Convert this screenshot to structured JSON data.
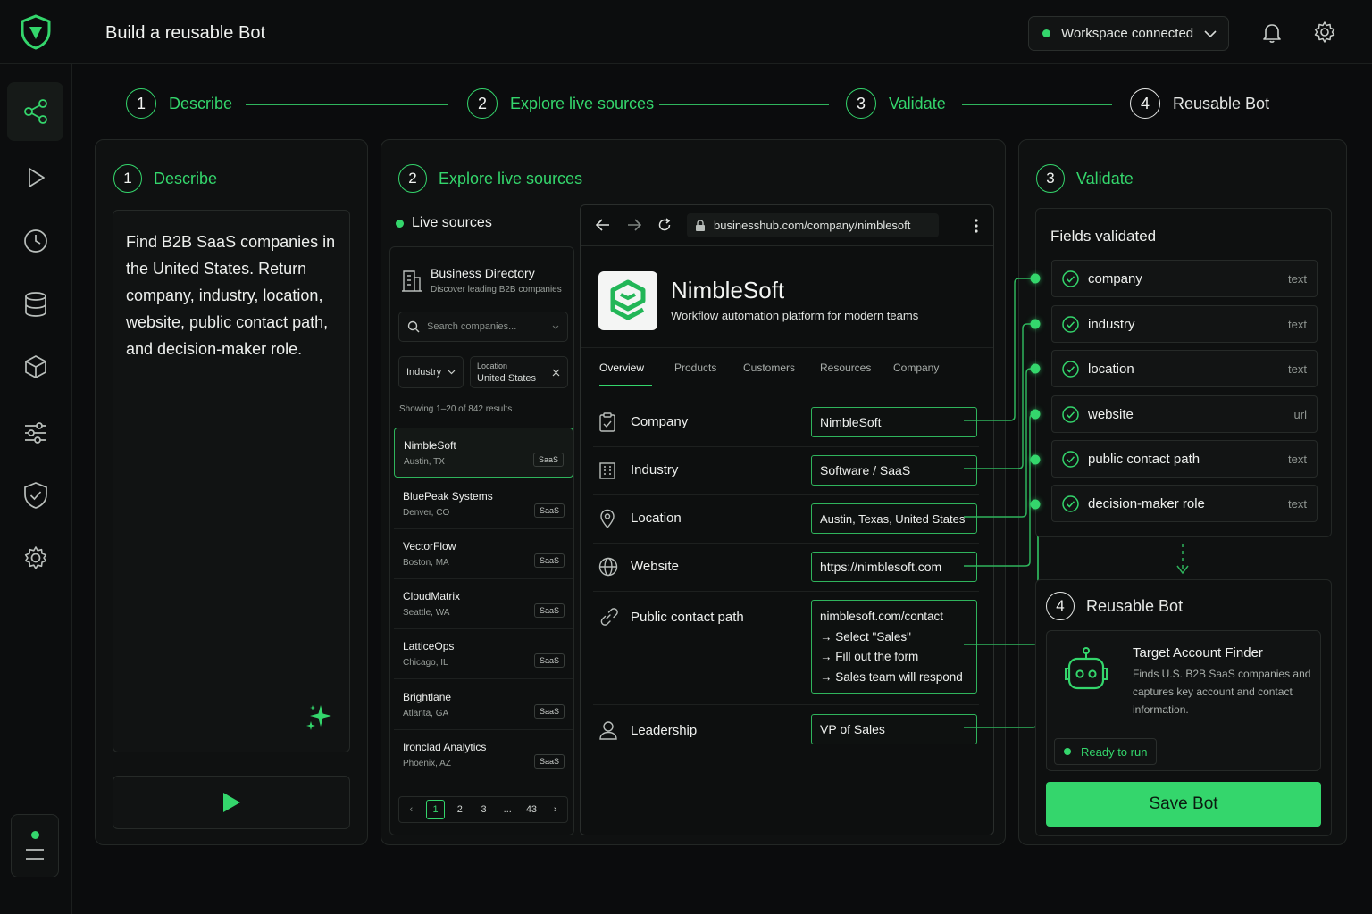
{
  "app": {
    "title": "Build a reusable Bot",
    "workspace_status": "Workspace connected"
  },
  "colors": {
    "accent": "#34d66c",
    "background": "#0b0c0d",
    "panel": "#0f1111"
  },
  "icons": {
    "logo": "shield-logo-icon",
    "topbar": [
      "bell-icon",
      "gear-icon"
    ],
    "sidebar": [
      "share-nodes-icon",
      "play-icon",
      "clock-icon",
      "database-icon",
      "cube-icon",
      "sliders-icon",
      "shield-check-icon",
      "settings-icon"
    ]
  },
  "stepper": [
    {
      "num": "1",
      "label": "Describe"
    },
    {
      "num": "2",
      "label": "Explore live sources"
    },
    {
      "num": "3",
      "label": "Validate"
    },
    {
      "num": "4",
      "label": "Reusable Bot"
    }
  ],
  "describe": {
    "num": "1",
    "title": "Describe",
    "prompt": "Find B2B SaaS companies in the United States. Return company, industry, location, website, public contact path, and decision-maker role."
  },
  "explore": {
    "num": "2",
    "title": "Explore live sources",
    "live_label": "Live sources",
    "directory": {
      "title": "Business Directory",
      "subtitle": "Discover leading B2B companies",
      "search_placeholder": "Search companies...",
      "filter_industry": "Industry",
      "filter_location_label": "Location",
      "filter_location_value": "United States",
      "showing": "Showing 1–20 of 842 results",
      "companies": [
        {
          "name": "NimbleSoft",
          "location": "Austin, TX",
          "tag": "SaaS"
        },
        {
          "name": "BluePeak Systems",
          "location": "Denver, CO",
          "tag": "SaaS"
        },
        {
          "name": "VectorFlow",
          "location": "Boston, MA",
          "tag": "SaaS"
        },
        {
          "name": "CloudMatrix",
          "location": "Seattle, WA",
          "tag": "SaaS"
        },
        {
          "name": "LatticeOps",
          "location": "Chicago, IL",
          "tag": "SaaS"
        },
        {
          "name": "Brightlane",
          "location": "Atlanta, GA",
          "tag": "SaaS"
        },
        {
          "name": "Ironclad Analytics",
          "location": "Phoenix, AZ",
          "tag": "SaaS"
        }
      ],
      "pagination": {
        "prev": "‹",
        "pages": [
          "1",
          "2",
          "3",
          "...",
          "43"
        ],
        "next": "›"
      }
    },
    "browser": {
      "url": "businesshub.com/company/nimblesoft",
      "company_name": "NimbleSoft",
      "tagline": "Workflow automation platform for modern teams",
      "tabs": [
        "Overview",
        "Products",
        "Customers",
        "Resources",
        "Company"
      ],
      "fields": [
        {
          "label": "Company",
          "value": "NimbleSoft"
        },
        {
          "label": "Industry",
          "value": "Software / SaaS"
        },
        {
          "label": "Location",
          "value": "Austin, Texas, United States"
        },
        {
          "label": "Website",
          "value": "https://nimblesoft.com"
        },
        {
          "label": "Public contact path",
          "lines": [
            "nimblesoft.com/contact",
            "→ Select \"Sales\"",
            "→ Fill out the form",
            "→ Sales team will respond"
          ]
        },
        {
          "label": "Leadership",
          "value": "VP of Sales"
        }
      ]
    }
  },
  "validate": {
    "num": "3",
    "title": "Validate",
    "box_title": "Fields validated",
    "fields": [
      {
        "name": "company",
        "type": "text"
      },
      {
        "name": "industry",
        "type": "text"
      },
      {
        "name": "location",
        "type": "text"
      },
      {
        "name": "website",
        "type": "url"
      },
      {
        "name": "public contact path",
        "type": "text"
      },
      {
        "name": "decision-maker role",
        "type": "text"
      }
    ]
  },
  "reusable": {
    "num": "4",
    "title": "Reusable Bot",
    "bot_name": "Target Account Finder",
    "bot_description": "Finds U.S. B2B SaaS companies and captures key account and contact information.",
    "status": "Ready to run",
    "save_label": "Save Bot"
  }
}
